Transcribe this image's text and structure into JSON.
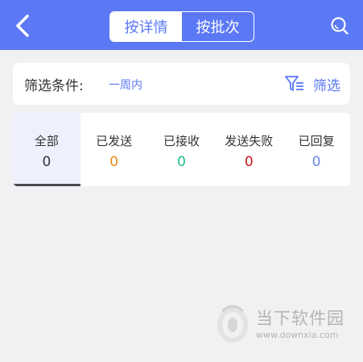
{
  "header": {
    "tabs": [
      {
        "label": "按详情",
        "active": true
      },
      {
        "label": "按批次",
        "active": false
      }
    ],
    "back_icon": "chevron-left-icon",
    "search_icon": "search-icon",
    "color": "#5b78f5"
  },
  "filter": {
    "label": "筛选条件:",
    "value": "一周内",
    "button_label": "筛选",
    "button_icon": "filter-icon"
  },
  "stats": [
    {
      "label": "全部",
      "count": "0",
      "color": "#333333",
      "active": true
    },
    {
      "label": "已发送",
      "count": "0",
      "color": "#e08a16",
      "active": false
    },
    {
      "label": "已接收",
      "count": "0",
      "color": "#1fbf85",
      "active": false
    },
    {
      "label": "发送失败",
      "count": "0",
      "color": "#c4161c",
      "active": false
    },
    {
      "label": "已回复",
      "count": "0",
      "color": "#6a86e8",
      "active": false
    }
  ],
  "watermark": {
    "title": "当下软件园",
    "url": "www.downxia.com"
  }
}
